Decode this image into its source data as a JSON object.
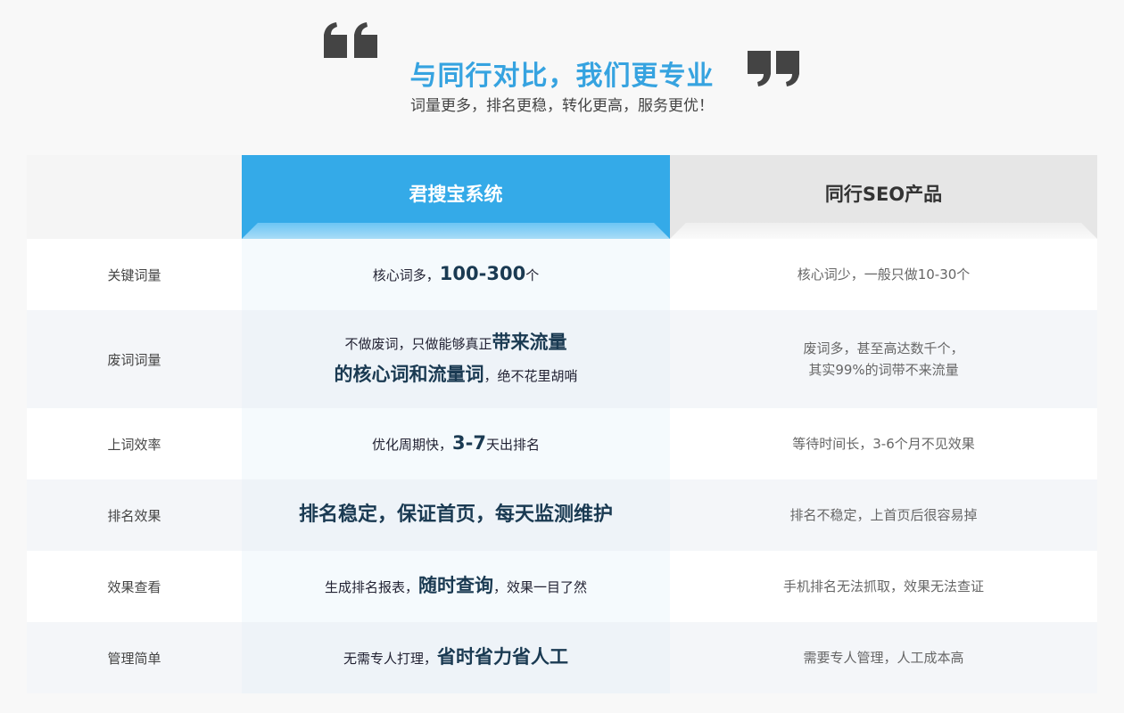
{
  "header": {
    "title": "与同行对比，我们更专业",
    "subtitle": "词量更多，排名更稳，转化更高，服务更优！",
    "quote_open_icon": "quote-open-icon",
    "quote_close_icon": "quote-close-icon",
    "quote_color": "#444444",
    "title_color": "#36a3e0"
  },
  "table": {
    "col_ours": "君搜宝系统",
    "col_peer": "同行SEO产品",
    "ours_color": "#34aae8",
    "peer_color": "#e6e6e6",
    "rows": [
      {
        "label": "关键词量",
        "ours": {
          "pre": "核心词多，",
          "hl": "100-300",
          "post": "个"
        },
        "peer": [
          "核心词少，一般只做10-30个"
        ]
      },
      {
        "label": "废词词量",
        "ours": {
          "pre": "不做废词，只做能够真正",
          "hl": "带来流量",
          "hl2": "的核心词和流量词",
          "post": "，绝不花里胡哨"
        },
        "peer": [
          "废词多，甚至高达数千个，",
          "其实99%的词带不来流量"
        ]
      },
      {
        "label": "上词效率",
        "ours": {
          "pre": "优化周期快，",
          "hl": "3-7",
          "post": "天出排名"
        },
        "peer": [
          "等待时间长，3-6个月不见效果"
        ]
      },
      {
        "label": "排名效果",
        "ours": {
          "pre": "",
          "hl": "排名稳定，保证首页，每天监测维护",
          "post": ""
        },
        "peer": [
          "排名不稳定，上首页后很容易掉"
        ]
      },
      {
        "label": "效果查看",
        "ours": {
          "pre": "生成排名报表，",
          "hl": "随时查询",
          "post": "，效果一目了然"
        },
        "peer": [
          "手机排名无法抓取，效果无法查证"
        ]
      },
      {
        "label": "管理简单",
        "ours": {
          "pre": "无需专人打理，",
          "hl": "省时省力省人工",
          "post": ""
        },
        "peer": [
          "需要专人管理，人工成本高"
        ]
      }
    ]
  }
}
